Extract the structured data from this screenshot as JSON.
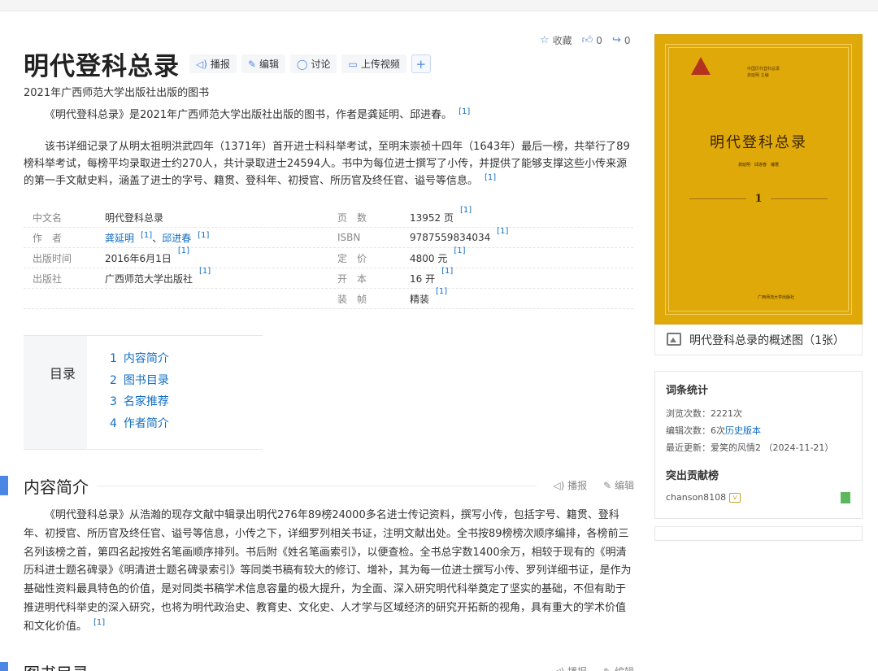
{
  "page": {
    "title": "明代登科总录",
    "subtitle": "2021年广西师范大学出版社出版的图书",
    "toolbar": [
      {
        "icon": "speaker-icon",
        "label": "播报"
      },
      {
        "icon": "pen-icon",
        "label": "编辑"
      },
      {
        "icon": "chat-icon",
        "label": "讨论"
      },
      {
        "icon": "video-icon",
        "label": "上传视频"
      }
    ],
    "plus_label": "+",
    "top_actions": {
      "favorite_label": "收藏",
      "like_count": "0",
      "share_count": "0"
    }
  },
  "intro": {
    "p1": "《明代登科总录》是2021年广西师范大学出版社出版的图书，作者是龚延明、邱进春。",
    "p1_ref": "[1]",
    "p2": "该书详细记录了从明太祖明洪武四年（1371年）首开进士科科举考试，至明末崇祯十四年（1643年）最后一榜，共举行了89榜科举考试，每榜平均录取进士约270人，共计录取进士24594人。书中为每位进士撰写了小传，并提供了能够支撑这些小传来源的第一手文献史料，涵盖了进士的字号、籍贯、登科年、初授官、所历官及终任官、谥号等信息。",
    "p2_ref": "[1]"
  },
  "info": {
    "left": [
      {
        "key": "中文名",
        "value": "明代登科总录",
        "ref": ""
      },
      {
        "key": "作　者",
        "value": "",
        "ref": ""
      },
      {
        "key": "出版时间",
        "value": "2016年6月1日",
        "ref": "[1]"
      },
      {
        "key": "出版社",
        "value": "广西师范大学出版社",
        "ref": "[1]"
      }
    ],
    "authors": [
      {
        "name": "龚延明",
        "ref": "[1]"
      },
      {
        "name": "邱进春",
        "ref": "[1]"
      }
    ],
    "author_sep": "、",
    "right": [
      {
        "key": "页　数",
        "value": "13952 页",
        "ref": "[1]"
      },
      {
        "key": "ISBN",
        "value": "9787559834034",
        "ref": "[1]"
      },
      {
        "key": "定　价",
        "value": "4800 元",
        "ref": "[1]"
      },
      {
        "key": "开　本",
        "value": "16 开",
        "ref": "[1]"
      },
      {
        "key": "装　帧",
        "value": "精装",
        "ref": "[1]"
      }
    ]
  },
  "catalog": {
    "heading": "目录",
    "items": [
      {
        "num": "1",
        "label": "内容简介"
      },
      {
        "num": "2",
        "label": "图书目录"
      },
      {
        "num": "3",
        "label": "名家推荐"
      },
      {
        "num": "4",
        "label": "作者简介"
      }
    ]
  },
  "section1": {
    "heading": "内容简介",
    "play_label": "播报",
    "edit_label": "编辑",
    "text": "《明代登科总录》从浩瀚的现存文献中辑录出明代276年89榜24000多名进士传记资料，撰写小传，包括字号、籍贯、登科年、初授官、所历官及终任官、谥号等信息，小传之下，详细罗列相关书证，注明文献出处。全书按89榜榜次顺序编排，各榜前三名列该榜之首，第四名起按姓名笔画顺序排列。书后附《姓名笔画索引》，以便查检。全书总字数1400余万，相较于现有的《明清历科进士题名碑录》《明清进士题名碑录索引》等同类书稿有较大的修订、增补，其为每一位进士撰写小传、罗列详细书证，是作为基础性资料最具特色的价值，是对同类书稿学术信息容量的极大提升，为全面、深入研究明代科举奠定了坚实的基础，不但有助于推进明代科举史的深入研究，也将为明代政治史、教育史、文化史、人才学与区域经济的研究开拓新的视角，具有重大的学术价值和文化价值。",
    "ref": "[1]"
  },
  "section2": {
    "heading": "图书目录",
    "play_label": "播报",
    "edit_label": "编辑"
  },
  "cover": {
    "series": "中国历代登科总录",
    "editor": "龚延明 主编",
    "title": "明代登科总录",
    "authors": "龚延明　邱进春　编著",
    "volume": "1",
    "publisher": "广西师范大学出版社",
    "caption": "明代登科总录的概述图（1张）"
  },
  "stats": {
    "heading": "词条统计",
    "views": "浏览次数：2221次",
    "edits_prefix": "编辑次数：6次",
    "history_link": "历史版本",
    "updated": "最近更新：爱笑的风情2 （2024-11-21）",
    "contrib_heading": "突出贡献榜",
    "contributor": "chanson8108",
    "badge": "V"
  },
  "colors": {
    "accent": "#4c87e6",
    "link": "#136ec2",
    "cover": "#e0a90a"
  }
}
